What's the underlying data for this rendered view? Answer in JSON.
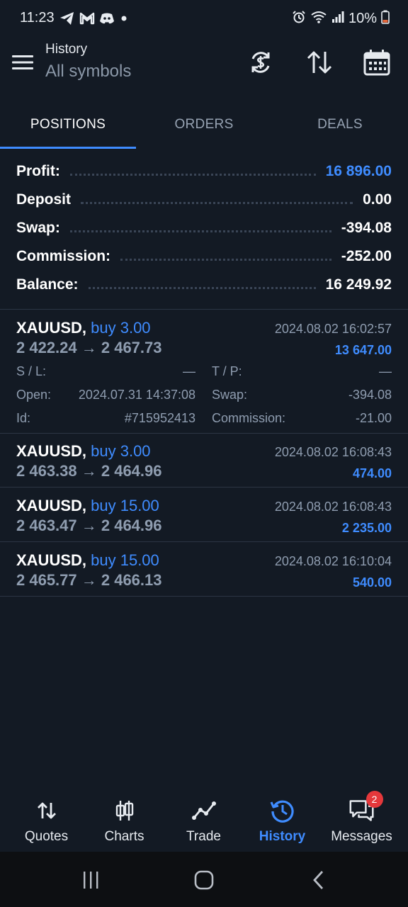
{
  "status_bar": {
    "time": "11:23",
    "battery": "10%",
    "left_icons": [
      "telegram-icon",
      "gmail-icon",
      "discord-icon",
      "dot-icon"
    ],
    "right_icons": [
      "alarm-icon",
      "wifi-icon",
      "signal-icon",
      "battery-icon"
    ]
  },
  "app_bar": {
    "title": "History",
    "subtitle": "All symbols",
    "actions": [
      "currency-exchange-icon",
      "sort-icon",
      "calendar-icon"
    ]
  },
  "tabs": [
    {
      "label": "POSITIONS",
      "active": true
    },
    {
      "label": "ORDERS",
      "active": false
    },
    {
      "label": "DEALS",
      "active": false
    }
  ],
  "summary": {
    "profit_label": "Profit:",
    "profit_value": "16 896.00",
    "deposit_label": "Deposit",
    "deposit_value": "0.00",
    "swap_label": "Swap:",
    "swap_value": "-394.08",
    "commission_label": "Commission:",
    "commission_value": "-252.00",
    "balance_label": "Balance:",
    "balance_value": "16 249.92"
  },
  "positions": [
    {
      "symbol": "XAUUSD,",
      "type": "buy 3.00",
      "prices": "2 422.24 → 2 467.73",
      "date": "2024.08.02 16:02:57",
      "profit": "13 647.00",
      "details": {
        "sl_label": "S / L:",
        "sl_value": "—",
        "tp_label": "T / P:",
        "tp_value": "—",
        "open_label": "Open:",
        "open_value": "2024.07.31 14:37:08",
        "swap_label": "Swap:",
        "swap_value": "-394.08",
        "id_label": "Id:",
        "id_value": "#715952413",
        "commission_label": "Commission:",
        "commission_value": "-21.00"
      }
    },
    {
      "symbol": "XAUUSD,",
      "type": "buy 3.00",
      "prices": "2 463.38 → 2 464.96",
      "date": "2024.08.02 16:08:43",
      "profit": "474.00"
    },
    {
      "symbol": "XAUUSD,",
      "type": "buy 15.00",
      "prices": "2 463.47 → 2 464.96",
      "date": "2024.08.02 16:08:43",
      "profit": "2 235.00"
    },
    {
      "symbol": "XAUUSD,",
      "type": "buy 15.00",
      "prices": "2 465.77 → 2 466.13",
      "date": "2024.08.02 16:10:04",
      "profit": "540.00"
    }
  ],
  "bottom_nav": [
    {
      "label": "Quotes",
      "icon": "quotes-arrows-icon",
      "active": false
    },
    {
      "label": "Charts",
      "icon": "candlestick-icon",
      "active": false
    },
    {
      "label": "Trade",
      "icon": "trade-line-icon",
      "active": false
    },
    {
      "label": "History",
      "icon": "history-clock-icon",
      "active": true
    },
    {
      "label": "Messages",
      "icon": "chat-bubbles-icon",
      "active": false,
      "badge": "2"
    }
  ],
  "colors": {
    "background": "#131a24",
    "accent": "#3f8cff",
    "muted": "#8f9db0",
    "badge": "#e5383b"
  }
}
